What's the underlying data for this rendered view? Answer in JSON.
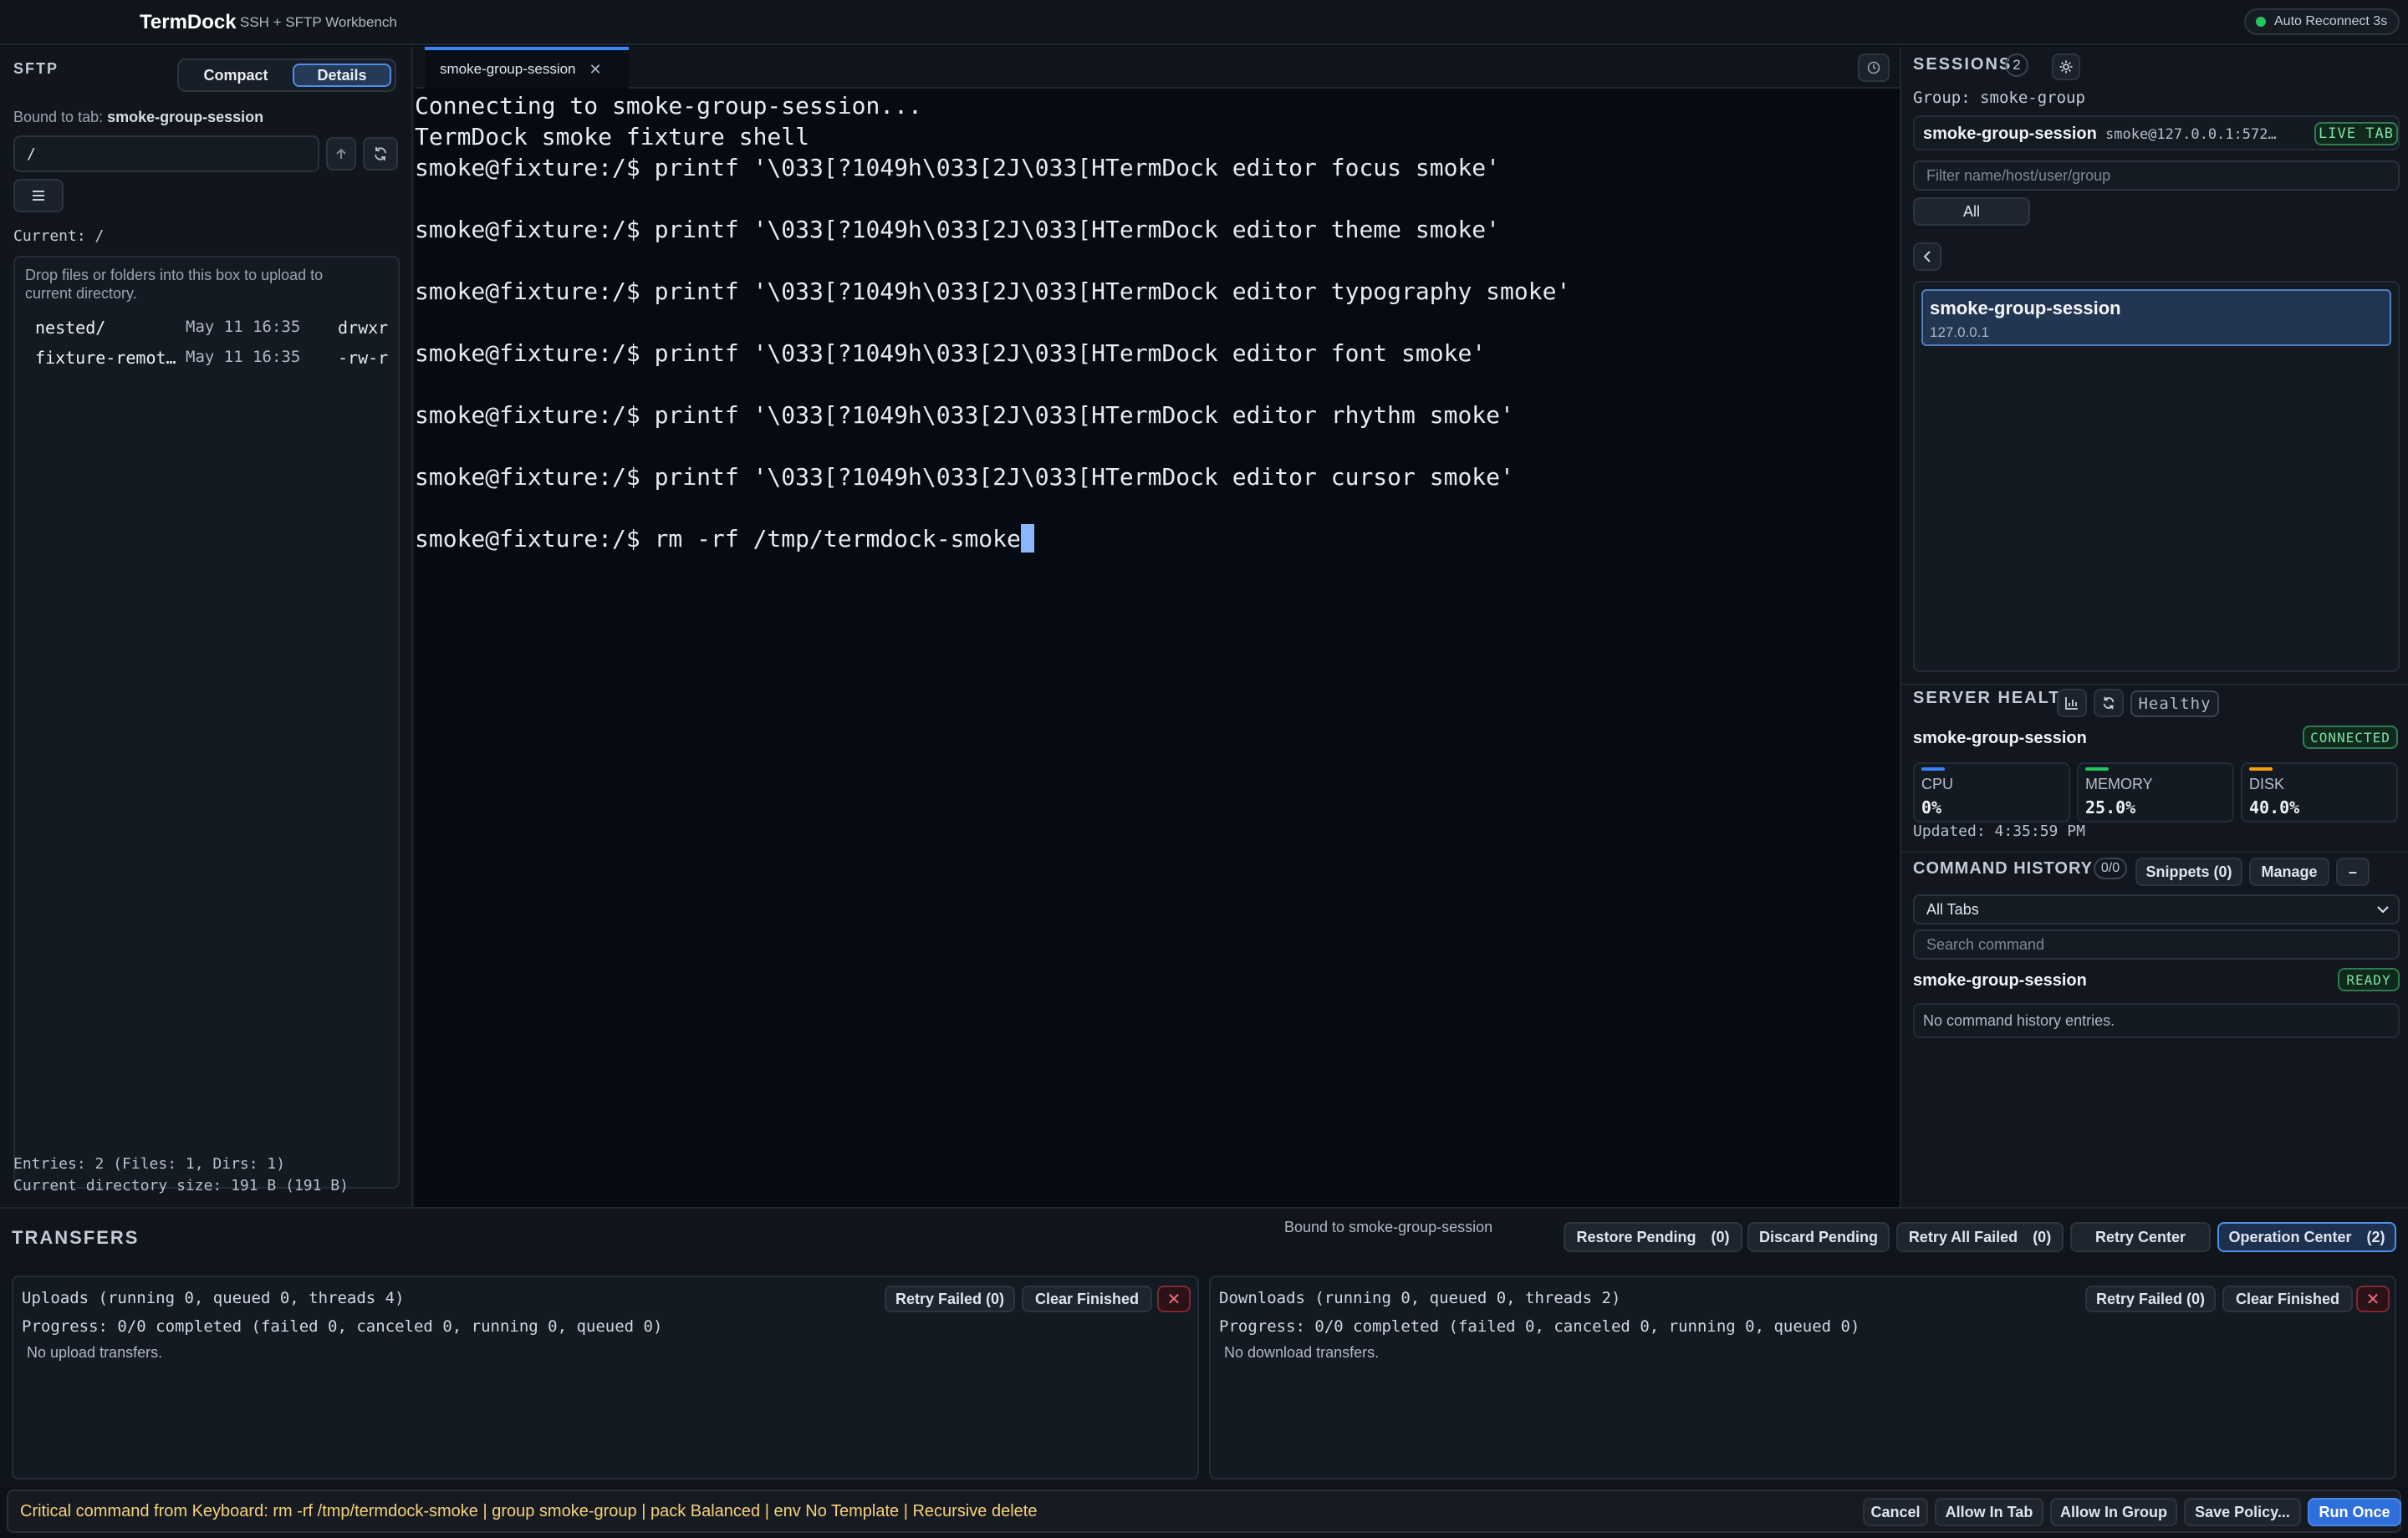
{
  "app": {
    "title": "TermDock",
    "subtitle": "SSH + SFTP Workbench",
    "auto_reconnect": "Auto Reconnect 3s"
  },
  "sftp": {
    "title": "SFTP",
    "view_compact": "Compact",
    "view_details": "Details",
    "bound_prefix": "Bound to tab:",
    "bound_tab": "smoke-group-session",
    "path_value": "/",
    "current": "Current: /",
    "drop_hint": "Drop files or folders into this box to upload to current directory.",
    "files": [
      {
        "name": "nested/",
        "date": "May 11 16:35",
        "perm": "drwxr"
      },
      {
        "name": "fixture-remot…",
        "date": "May 11 16:35",
        "perm": "-rw-r"
      }
    ],
    "entries": "Entries: 2 (Files: 1, Dirs: 1)",
    "dir_size": "Current directory size: 191 B (191 B)"
  },
  "terminal": {
    "tab_label": "smoke-group-session",
    "lines": [
      "Connecting to smoke-group-session...",
      "TermDock smoke fixture shell",
      "smoke@fixture:/$ printf '\\033[?1049h\\033[2J\\033[HTermDock editor focus smoke'",
      "",
      "smoke@fixture:/$ printf '\\033[?1049h\\033[2J\\033[HTermDock editor theme smoke'",
      "",
      "smoke@fixture:/$ printf '\\033[?1049h\\033[2J\\033[HTermDock editor typography smoke'",
      "",
      "smoke@fixture:/$ printf '\\033[?1049h\\033[2J\\033[HTermDock editor font smoke'",
      "",
      "smoke@fixture:/$ printf '\\033[?1049h\\033[2J\\033[HTermDock editor rhythm smoke'",
      "",
      "smoke@fixture:/$ printf '\\033[?1049h\\033[2J\\033[HTermDock editor cursor smoke'",
      "",
      "smoke@fixture:/$ rm -rf /tmp/termdock-smoke"
    ]
  },
  "sessions": {
    "title": "SESSIONS",
    "count": "2",
    "group": "Group: smoke-group",
    "live_name": "smoke-group-session",
    "live_host": "smoke@127.0.0.1:572…",
    "live_badge": "LIVE TAB",
    "filter_placeholder": "Filter name/host/user/group",
    "filter_all": "All",
    "items": [
      {
        "name": "smoke-group-session",
        "host": "127.0.0.1"
      }
    ]
  },
  "health": {
    "title": "SERVER HEALTH",
    "status": "Healthy",
    "session": "smoke-group-session",
    "conn_badge": "CONNECTED",
    "metrics": [
      {
        "label": "CPU",
        "value": "0%",
        "color": "#3b82f6"
      },
      {
        "label": "MEMORY",
        "value": "25.0%",
        "color": "#22c55e"
      },
      {
        "label": "DISK",
        "value": "40.0%",
        "color": "#f59e0b"
      }
    ],
    "updated": "Updated: 4:35:59 PM"
  },
  "history": {
    "title": "COMMAND HISTORY",
    "count": "0/0",
    "snippets": "Snippets (0)",
    "manage": "Manage",
    "collapse": "–",
    "scope": "All Tabs",
    "search_placeholder": "Search command",
    "session": "smoke-group-session",
    "ready_badge": "READY",
    "empty": "No command history entries."
  },
  "transfers": {
    "title": "TRANSFERS",
    "bound": "Bound to smoke-group-session",
    "restore": "Restore Pending",
    "restore_count": "(0)",
    "discard": "Discard Pending",
    "retry_all": "Retry All Failed",
    "retry_all_count": "(0)",
    "retry_center": "Retry Center",
    "op_center": "Operation Center",
    "op_count": "(2)",
    "uploads": {
      "header": "Uploads (running 0, queued 0, threads 4)",
      "progress": "Progress: 0/0 completed (failed 0, canceled 0, running 0, queued 0)",
      "empty": "No upload transfers.",
      "retry": "Retry Failed (0)",
      "clear": "Clear Finished"
    },
    "downloads": {
      "header": "Downloads (running 0, queued 0, threads 2)",
      "progress": "Progress: 0/0 completed (failed 0, canceled 0, running 0, queued 0)",
      "empty": "No download transfers.",
      "retry": "Retry Failed (0)",
      "clear": "Clear Finished"
    }
  },
  "alert": {
    "text": "Critical command from Keyboard: rm -rf /tmp/termdock-smoke | group smoke-group | pack Balanced | env No Template | Recursive delete",
    "cancel": "Cancel",
    "allow_tab": "Allow In Tab",
    "allow_group": "Allow In Group",
    "save_policy": "Save Policy...",
    "run_once": "Run Once"
  }
}
